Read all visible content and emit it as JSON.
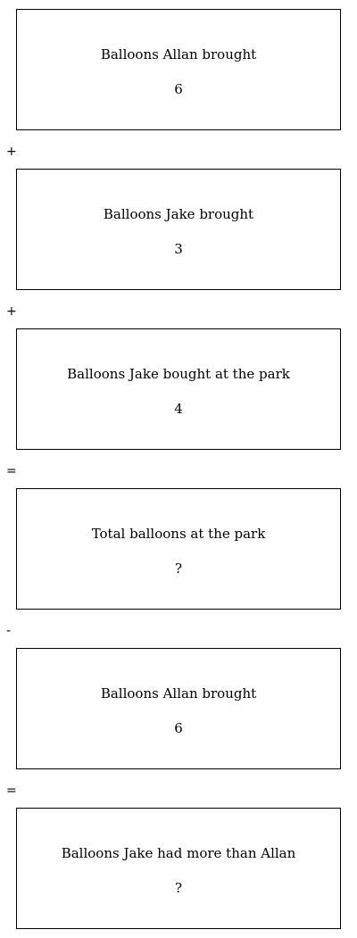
{
  "steps": [
    {
      "label": "Balloons Allan brought",
      "value": "6"
    },
    {
      "label": "Balloons Jake brought",
      "value": "3"
    },
    {
      "label": "Balloons Jake bought at the park",
      "value": "4"
    },
    {
      "label": "Total balloons at the park",
      "value": "?"
    },
    {
      "label": "Balloons Allan brought",
      "value": "6"
    },
    {
      "label": "Balloons Jake had more than Allan",
      "value": "?"
    }
  ],
  "operators": [
    "+",
    "+",
    "=",
    "-",
    "="
  ]
}
